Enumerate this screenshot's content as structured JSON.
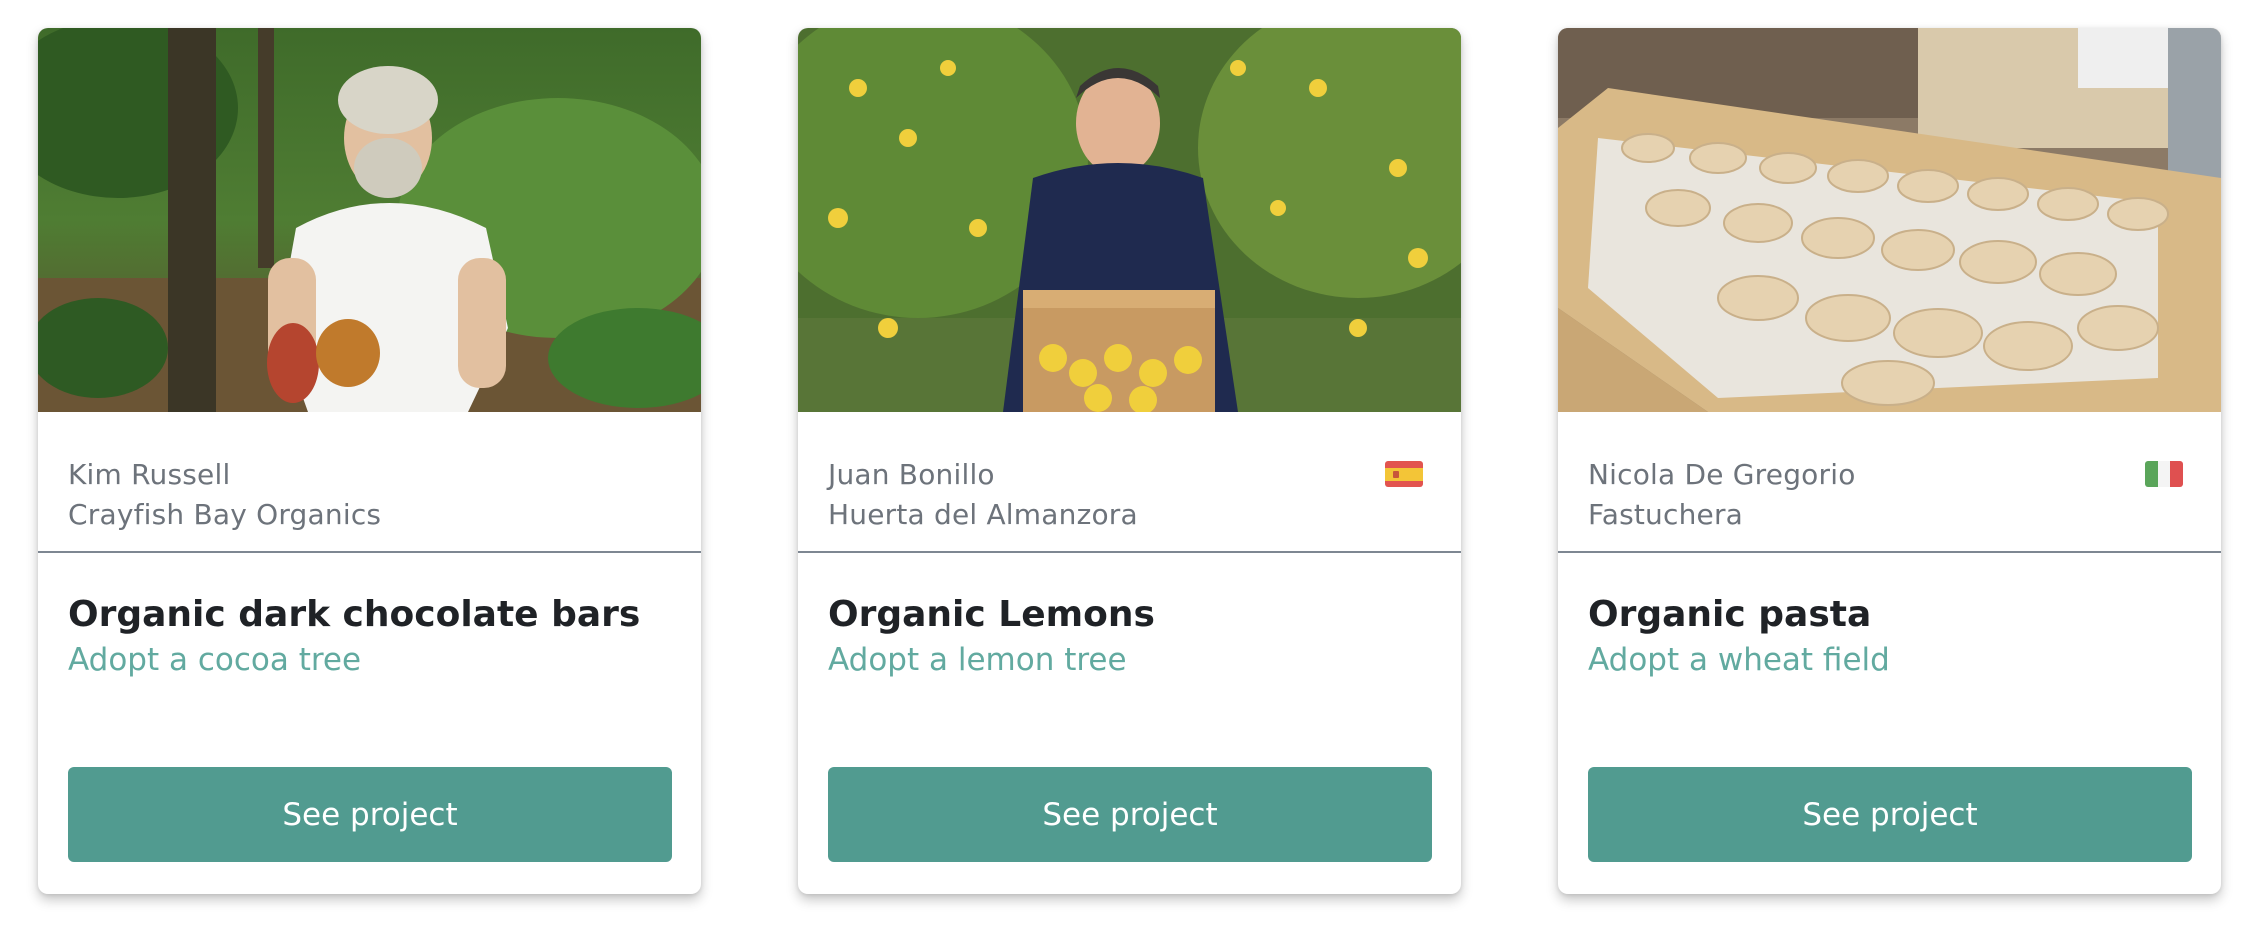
{
  "cards": [
    {
      "photo_icon": "cocoa-farmer-photo",
      "producer_name": "Kim Russell",
      "producer_farm": "Crayfish Bay Organics",
      "flag": null,
      "title": "Organic dark chocolate bars",
      "subtitle": "Adopt a cocoa tree",
      "button_label": "See project"
    },
    {
      "photo_icon": "lemon-farmer-photo",
      "producer_name": "Juan Bonillo",
      "producer_farm": "Huerta del Almanzora",
      "flag": "spain-flag-icon",
      "title": "Organic Lemons",
      "subtitle": "Adopt a lemon tree",
      "button_label": "See project"
    },
    {
      "photo_icon": "pasta-drying-photo",
      "producer_name": "Nicola De Gregorio",
      "producer_farm": "Fastuchera",
      "flag": "italy-flag-icon",
      "title": "Organic pasta",
      "subtitle": "Adopt a wheat field",
      "button_label": "See project"
    }
  ],
  "colors": {
    "button": "#519b90",
    "subtitle": "#62aaa0",
    "title": "#1f2226",
    "producer_text": "#6d737b",
    "divider": "#7e8792"
  }
}
